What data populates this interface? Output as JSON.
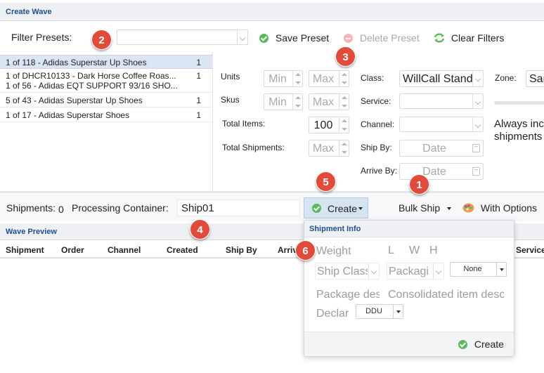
{
  "create_wave": {
    "title": "Create Wave"
  },
  "filter": {
    "presets_label": "Filter Presets:",
    "save_preset": "Save Preset",
    "delete_preset": "Delete Preset",
    "clear_filters": "Clear Filters"
  },
  "presets": [
    {
      "name": "1 of 118 - Adidas Superstar Up Shoes",
      "count": "1"
    },
    {
      "name": "1 of DHCR10133 - Dark Horse Coffee Roas...",
      "name2": "1 of 56 - Adidas EQT SUPPORT 93/16 SHO...",
      "count": "1"
    },
    {
      "name": "5 of 43 - Adidas Superstar Up Shoes",
      "count": "1"
    },
    {
      "name": "1 of 17 - Adidas Superstar Shoes",
      "count": "1"
    }
  ],
  "ranges": {
    "units_label": "Units",
    "skus_label": "Skus",
    "total_items_label": "Total Items:",
    "total_shipments_label": "Total Shipments:",
    "min_placeholder": "Min",
    "max_placeholder": "Max",
    "total_items_value": "100"
  },
  "filters2": {
    "class_label": "Class:",
    "class_value": "WillCall Stand",
    "service_label": "Service:",
    "channel_label": "Channel:",
    "ship_by_label": "Ship By:",
    "arrive_by_label": "Arrive By:",
    "date_placeholder": "Date",
    "zone_label": "Zone:",
    "zone_value": "San",
    "always_text_1": "Always inc",
    "always_text_2": "shipments"
  },
  "toolbar": {
    "shipments_label": "Shipments:",
    "shipments_count": "0",
    "processing_label": "Processing Container:",
    "processing_value": "Ship01",
    "create_label": "Create",
    "bulk_ship_label": "Bulk Ship",
    "with_options_label": "With Options"
  },
  "wave_preview": {
    "title": "Wave Preview",
    "columns": [
      "Shipment",
      "Order",
      "Channel",
      "Created",
      "Ship By",
      "Arriv",
      "Service"
    ]
  },
  "shipment_info": {
    "title": "Shipment Info",
    "weight_placeholder": "Weight",
    "l": "L",
    "w": "W",
    "h": "H",
    "ship_class_placeholder": "Ship Class",
    "packaging_placeholder": "Packagi",
    "none_value": "None",
    "package_desc_placeholder": "Package des",
    "consolidated_placeholder": "Consolidated item desc",
    "declared_placeholder": "Declar",
    "ddu_value": "DDU",
    "create_label": "Create"
  },
  "badges": [
    "1",
    "2",
    "3",
    "4",
    "5",
    "6"
  ],
  "colors": {
    "accent": "#1f4e8c",
    "badge": "#e04b3c",
    "create_button": "#d6e3f1",
    "selected_row": "#dbe6f5"
  }
}
